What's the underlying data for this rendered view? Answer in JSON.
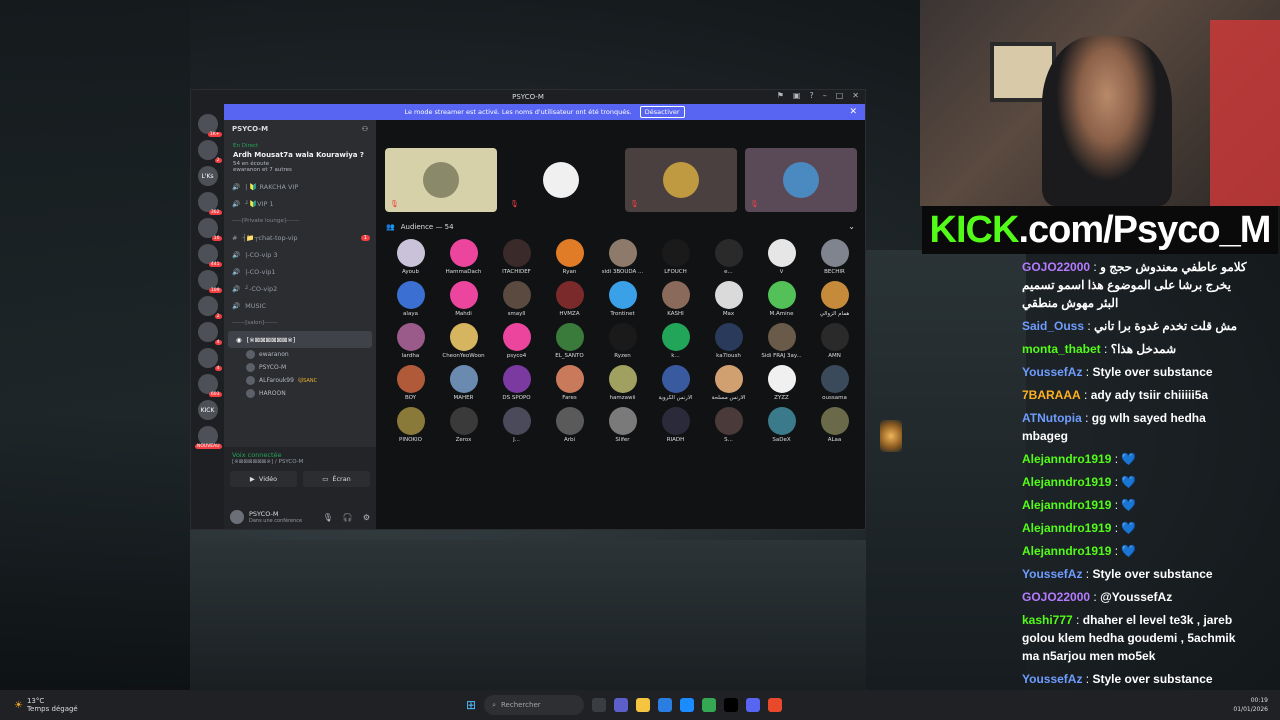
{
  "discord": {
    "window_title": "PSYCO-M",
    "banner_text": "Le mode streamer est activé. Les noms d'utilisateur ont été tronqués.",
    "banner_button": "Désactiver",
    "servers": [
      {
        "label": "",
        "badge": "1K+"
      },
      {
        "label": "",
        "badge": "2"
      },
      {
        "label": "L'Ks",
        "badge": ""
      },
      {
        "label": "",
        "badge": "362"
      },
      {
        "label": "",
        "badge": "16"
      },
      {
        "label": "",
        "badge": "441"
      },
      {
        "label": "",
        "badge": "109"
      },
      {
        "label": "",
        "badge": "2"
      },
      {
        "label": "",
        "badge": "4"
      },
      {
        "label": "",
        "badge": "4"
      },
      {
        "label": "",
        "badge": "603"
      },
      {
        "label": "KICK",
        "badge": ""
      },
      {
        "label": "",
        "badge": "NOUVEAU"
      }
    ],
    "server_name": "PSYCO-M",
    "live": {
      "badge": "En Direct",
      "title": "Ardh Mousat7a wala Kourawiya ?",
      "listeners": "54 en écoute",
      "others": "ewaranon et 7 autres"
    },
    "channels": [
      {
        "name": "| 🔰 RAKCHA VIP",
        "type": "voice"
      },
      {
        "name": "┘🔰VIP 1",
        "type": "voice"
      },
      {
        "name": "┈┈┈[Private lounge]┈┈┈┈",
        "type": "category"
      },
      {
        "name": "┤📁┬chat-top-vip",
        "type": "text",
        "badge": "1"
      },
      {
        "name": "|-CO-vip 3",
        "type": "voice"
      },
      {
        "name": "|-CO-vip1",
        "type": "voice"
      },
      {
        "name": "┘-CO-vip2",
        "type": "voice"
      },
      {
        "name": "MUSIC",
        "type": "voice"
      },
      {
        "name": "┈┈┈┈[salon]┈┈┈┈",
        "type": "category"
      }
    ],
    "active_channel": {
      "name": "[※⊠⊠⊠⊠⊠⊠※]",
      "subtitle": "Ardh Mousat7a wala Kourawiya ?",
      "badge": "26"
    },
    "members": [
      {
        "name": "ewaranon",
        "tag": ""
      },
      {
        "name": "PSYCO-M",
        "tag": ""
      },
      {
        "name": "ALFarouk99",
        "tag": "🐱SANC"
      },
      {
        "name": "HAROON",
        "tag": ""
      }
    ],
    "voice_connected": "Voix connectée",
    "voice_sub": "[※⊠⊠⊠⊠⊠⊠※] / PSYCO-M",
    "video_label": "Vidéo",
    "screen_label": "Écran",
    "user_name": "PSYCO-M",
    "user_status": "Dans une conférence",
    "audience_label": "Audience — 54",
    "audience": [
      {
        "name": "Ayoub",
        "color": "#c9c2d8"
      },
      {
        "name": "HammaDach",
        "color": "#eb459e"
      },
      {
        "name": "ITACHIDEF",
        "color": "#3b2a2a"
      },
      {
        "name": "Ryan",
        "color": "#e07b28"
      },
      {
        "name": "sidi 3BOUDA ...",
        "color": "#8d7a6a"
      },
      {
        "name": "LFOUCH",
        "color": "#1a1a1a"
      },
      {
        "name": "e...",
        "color": "#2a2a2a"
      },
      {
        "name": "V",
        "color": "#e6e6e6"
      },
      {
        "name": "BECHIR",
        "color": "#80848e"
      },
      {
        "name": "alaya",
        "color": "#3b6fd1"
      },
      {
        "name": "Mahdi",
        "color": "#eb459e"
      },
      {
        "name": "smayll",
        "color": "#5a4a40"
      },
      {
        "name": "HVMZA",
        "color": "#7a2a2a"
      },
      {
        "name": "Trontinet",
        "color": "#3aa0e8"
      },
      {
        "name": "KASHI",
        "color": "#8a6a5a"
      },
      {
        "name": "Max",
        "color": "#dadada"
      },
      {
        "name": "M.Amine",
        "color": "#53c058"
      },
      {
        "name": "همام الزوالي",
        "color": "#c58a3a"
      },
      {
        "name": "lardha",
        "color": "#9a5a8a"
      },
      {
        "name": "CheonYeoWoon",
        "color": "#d6b560"
      },
      {
        "name": "psyco4",
        "color": "#eb459e"
      },
      {
        "name": "EL_SANTO",
        "color": "#3a7a3a"
      },
      {
        "name": "Ryzen",
        "color": "#1a1a1a"
      },
      {
        "name": "k...",
        "color": "#23a559"
      },
      {
        "name": "ka7loush",
        "color": "#2a3a5a"
      },
      {
        "name": "Sidi FRAJ 3ay...",
        "color": "#6a5a4a"
      },
      {
        "name": "AMN",
        "color": "#2a2a2a"
      },
      {
        "name": "BOY",
        "color": "#b05a3a"
      },
      {
        "name": "MAHER",
        "color": "#6a8ab0"
      },
      {
        "name": "DS SPOPO",
        "color": "#7a3aa0"
      },
      {
        "name": "Fares",
        "color": "#c87a5a"
      },
      {
        "name": "hamzawii",
        "color": "#a0a060"
      },
      {
        "name": "الأرنس الكروية",
        "color": "#3a5aa0"
      },
      {
        "name": "الأرنس مسلحة",
        "color": "#d0a070"
      },
      {
        "name": "ZYZZ",
        "color": "#f0f0f0"
      },
      {
        "name": "oussama",
        "color": "#3a4a5a"
      },
      {
        "name": "PINOKIO",
        "color": "#8a7a3a"
      },
      {
        "name": "Zerox",
        "color": "#3a3a3a"
      },
      {
        "name": "J...",
        "color": "#4a4a5a"
      },
      {
        "name": "Arbi",
        "color": "#5a5a5a"
      },
      {
        "name": "Slifer",
        "color": "#7a7a7a"
      },
      {
        "name": "RIADH",
        "color": "#2a2a3a"
      },
      {
        "name": "S...",
        "color": "#4a3a3a"
      },
      {
        "name": "SaDeX",
        "color": "#3a7a8a"
      },
      {
        "name": "ALaa",
        "color": "#6a6a4a"
      }
    ]
  },
  "kick_banner": {
    "brand": "KICK",
    "suffix": ".com/Psyco_M"
  },
  "chat": [
    {
      "user": "GOJO22000",
      "color": "#b57bff",
      "text": "كلامو عاطفي معندوش حجج و يخرج برشا على الموضوع هذا اسمو تسميم البئر مهوش منطقي",
      "rtl": true
    },
    {
      "user": "Said_Ouss",
      "color": "#6f9cff",
      "text": "مش قلت تخدم غدوة برا تاني",
      "rtl": true
    },
    {
      "user": "monta_thabet",
      "color": "#53fc18",
      "text": "شمدخل هذا؟",
      "rtl": true
    },
    {
      "user": "YoussefAz",
      "color": "#6f9cff",
      "text": "Style over substance",
      "rtl": false
    },
    {
      "user": "7BARAAA",
      "color": "#ffb020",
      "text": "ady ady tsiir chiiiii5a",
      "rtl": false
    },
    {
      "user": "ATNutopia",
      "color": "#6f9cff",
      "text": "gg wlh sayed hedha mbageg",
      "rtl": false
    },
    {
      "user": "Alejanndro1919",
      "color": "#53fc18",
      "text": "💙",
      "rtl": false
    },
    {
      "user": "Alejanndro1919",
      "color": "#53fc18",
      "text": "💙",
      "rtl": false
    },
    {
      "user": "Alejanndro1919",
      "color": "#53fc18",
      "text": "💙",
      "rtl": false
    },
    {
      "user": "Alejanndro1919",
      "color": "#53fc18",
      "text": "💙",
      "rtl": false
    },
    {
      "user": "Alejanndro1919",
      "color": "#53fc18",
      "text": "💙",
      "rtl": false
    },
    {
      "user": "YoussefAz",
      "color": "#6f9cff",
      "text": "Style over substance",
      "rtl": false
    },
    {
      "user": "GOJO22000",
      "color": "#b57bff",
      "text": "@YoussefAz",
      "rtl": false
    },
    {
      "user": "kashi777",
      "color": "#53fc18",
      "text": "dhaher el level te3k , jareb golou klem hedha goudemi , 5achmik ma n5arjou men mo5ek",
      "rtl": false
    },
    {
      "user": "YoussefAz",
      "color": "#6f9cff",
      "text": "Style over substance",
      "rtl": false
    }
  ],
  "taskbar": {
    "temp": "13°C",
    "weather": "Temps dégagé",
    "search_placeholder": "Rechercher",
    "time": "00:19",
    "date": "01/01/2026"
  }
}
